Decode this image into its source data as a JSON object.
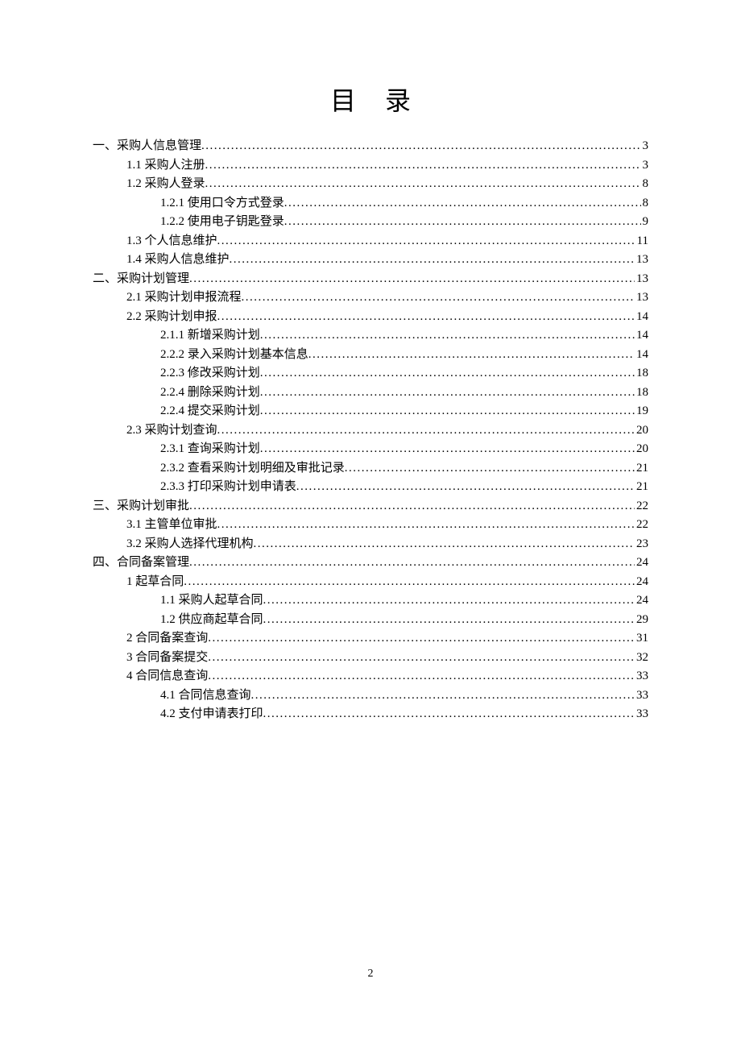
{
  "title": "目录",
  "page_number": "2",
  "toc": [
    {
      "level": 0,
      "label": "一、采购人信息管理",
      "page": "3"
    },
    {
      "level": 1,
      "label": "1.1 采购人注册",
      "page": "3"
    },
    {
      "level": 1,
      "label": "1.2 采购人登录",
      "page": "8"
    },
    {
      "level": 2,
      "label": "1.2.1 使用口令方式登录",
      "page": "8"
    },
    {
      "level": 2,
      "label": "1.2.2 使用电子钥匙登录",
      "page": "9"
    },
    {
      "level": 1,
      "label": "1.3 个人信息维护",
      "page": "11"
    },
    {
      "level": 1,
      "label": "1.4 采购人信息维护",
      "page": "13"
    },
    {
      "level": 0,
      "label": "二、采购计划管理",
      "page": "13"
    },
    {
      "level": 1,
      "label": "2.1 采购计划申报流程",
      "page": "13"
    },
    {
      "level": 1,
      "label": "2.2 采购计划申报",
      "page": "14"
    },
    {
      "level": 2,
      "label": "2.1.1 新增采购计划",
      "page": "14"
    },
    {
      "level": 2,
      "label": "2.2.2 录入采购计划基本信息",
      "page": "14"
    },
    {
      "level": 2,
      "label": "2.2.3 修改采购计划",
      "page": "18"
    },
    {
      "level": 2,
      "label": "2.2.4 删除采购计划",
      "page": "18"
    },
    {
      "level": 2,
      "label": "2.2.4 提交采购计划",
      "page": "19"
    },
    {
      "level": 1,
      "label": "2.3 采购计划查询",
      "page": "20"
    },
    {
      "level": 2,
      "label": "2.3.1 查询采购计划",
      "page": "20"
    },
    {
      "level": 2,
      "label": "2.3.2 查看采购计划明细及审批记录",
      "page": "21"
    },
    {
      "level": 2,
      "label": "2.3.3 打印采购计划申请表",
      "page": "21"
    },
    {
      "level": 0,
      "label": "三、采购计划审批",
      "page": "22"
    },
    {
      "level": 1,
      "label": "3.1 主管单位审批",
      "page": "22"
    },
    {
      "level": 1,
      "label": "3.2 采购人选择代理机构",
      "page": "23"
    },
    {
      "level": 0,
      "label": "四、合同备案管理",
      "page": "24"
    },
    {
      "level": 1,
      "label": "1 起草合同",
      "page": "24"
    },
    {
      "level": 2,
      "label": "1.1 采购人起草合同",
      "page": "24"
    },
    {
      "level": 2,
      "label": "1.2 供应商起草合同",
      "page": "29"
    },
    {
      "level": 1,
      "label": "2 合同备案查询",
      "page": "31"
    },
    {
      "level": 1,
      "label": "3 合同备案提交",
      "page": "32"
    },
    {
      "level": 1,
      "label": "4 合同信息查询",
      "page": "33"
    },
    {
      "level": 2,
      "label": "4.1 合同信息查询",
      "page": "33"
    },
    {
      "level": 2,
      "label": "4.2 支付申请表打印",
      "page": "33"
    }
  ]
}
